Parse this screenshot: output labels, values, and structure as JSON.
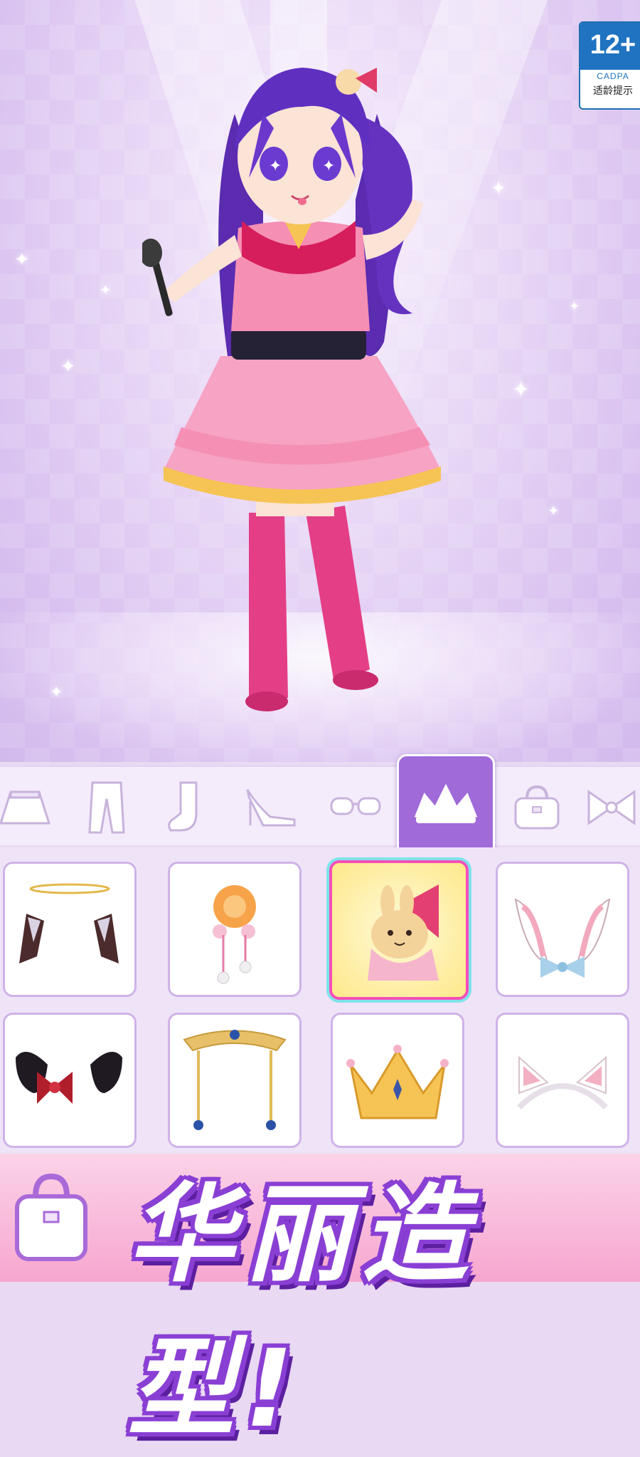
{
  "age_rating": {
    "label": "12+",
    "org": "CADPA",
    "note": "适龄提示"
  },
  "categories": [
    {
      "name": "skirt-icon"
    },
    {
      "name": "pants-icon"
    },
    {
      "name": "socks-icon"
    },
    {
      "name": "high-heel-icon"
    },
    {
      "name": "glasses-icon"
    },
    {
      "name": "tiara-icon",
      "active": true
    },
    {
      "name": "handbag-icon"
    },
    {
      "name": "bow-icon"
    }
  ],
  "items": [
    {
      "name": "halo-wings-accessory"
    },
    {
      "name": "flower-hairpin-accessory"
    },
    {
      "name": "bunny-bow-hairclip",
      "selected": true
    },
    {
      "name": "bunny-ears-headband"
    },
    {
      "name": "black-bunny-ears-bow"
    },
    {
      "name": "golden-jeweled-headpiece"
    },
    {
      "name": "golden-crown"
    },
    {
      "name": "cat-ears-headband"
    }
  ],
  "banner": {
    "text": "华丽造型!"
  },
  "colors": {
    "accent": "#a06ad8",
    "selected_border": "#f44fb9",
    "banner_outline": "#8a3fd4"
  }
}
